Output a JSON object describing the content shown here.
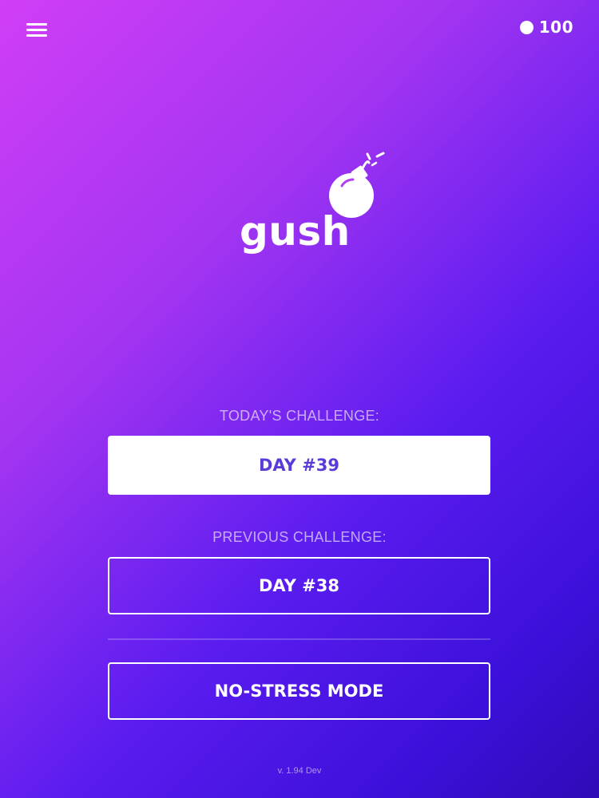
{
  "header": {
    "menu_icon": "hamburger-menu-icon",
    "coin_icon": "coin-icon",
    "coin_count": "100"
  },
  "logo": {
    "word": "gush",
    "icon": "bomb-icon"
  },
  "today": {
    "label": "TODAY'S CHALLENGE:",
    "button_label": "DAY #39"
  },
  "previous": {
    "label": "PREVIOUS CHALLENGE:",
    "button_label": "DAY #38"
  },
  "no_stress": {
    "button_label": "NO-STRESS MODE"
  },
  "footer": {
    "version": "v. 1.94 Dev"
  },
  "colors": {
    "gradient_start": "#d03ef6",
    "gradient_end": "#2f0bb6",
    "primary_button_text": "#5a3ad8",
    "white": "#ffffff"
  }
}
